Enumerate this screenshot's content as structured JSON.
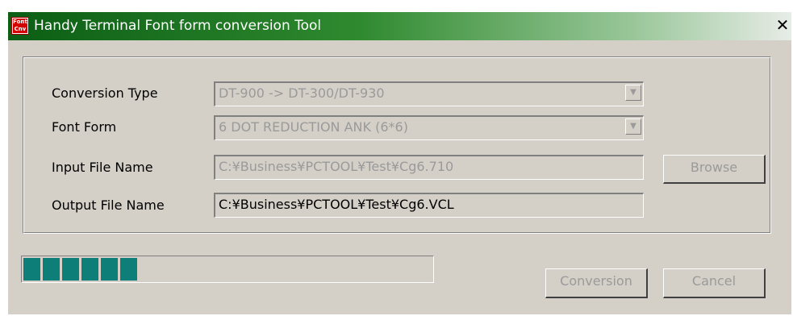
{
  "window": {
    "title": "Handy Terminal Font form conversion Tool",
    "icon_top": "Font",
    "icon_bottom": "Cnv",
    "close_label": "✕"
  },
  "form": {
    "conversion_type": {
      "label": "Conversion Type",
      "value": "DT-900 -> DT-300/DT-930",
      "icon": "chevron-down-icon"
    },
    "font_form": {
      "label": "Font Form",
      "value": "6 DOT REDUCTION ANK (6*6)",
      "icon": "chevron-down-icon"
    },
    "input_file": {
      "label": "Input File Name",
      "value": "C:¥Business¥PCTOOL¥Test¥Cg6.710"
    },
    "output_file": {
      "label": "Output File Name",
      "value": "C:¥Business¥PCTOOL¥Test¥Cg6.VCL"
    }
  },
  "buttons": {
    "browse": "Browse",
    "conversion": "Conversion",
    "cancel": "Cancel"
  },
  "progress": {
    "filled_segments": 6,
    "total_segments": 23,
    "color": "#0d7f78"
  }
}
